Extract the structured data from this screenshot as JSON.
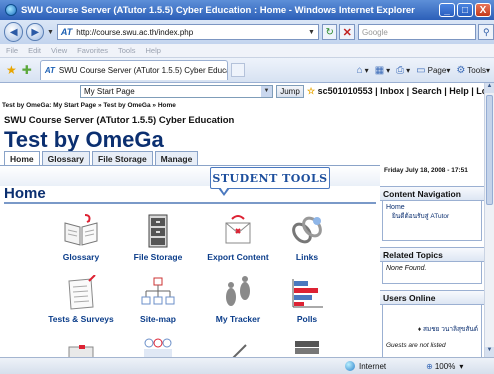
{
  "window": {
    "title": "SWU Course Server (ATutor 1.5.5) Cyber Education : Home - Windows Internet Explorer",
    "minimize": "_",
    "maximize": "□",
    "close": "X"
  },
  "address": {
    "url": "http://course.swu.ac.th/index.php",
    "search_placeholder": "Google"
  },
  "menu": [
    "File",
    "Edit",
    "View",
    "Favorites",
    "Tools",
    "Help"
  ],
  "browser_tab": {
    "label": "SWU Course Server (ATutor 1.5.5) Cyber Education :...",
    "tools": [
      {
        "icon": "page-icon",
        "label": "Page"
      },
      {
        "icon": "tools-icon",
        "label": "Tools"
      }
    ]
  },
  "page": {
    "jump_select": "My Start Page",
    "jump_button": "Jump",
    "userbar": "sc501010553 | Inbox | Search | Help | Log-out",
    "breadcrumb": "Test by OmeGa: My Start Page » Test by OmeGa » Home",
    "server_title": "SWU Course Server (ATutor 1.5.5) Cyber Education",
    "course_title": "Test by OmeGa",
    "tabs": [
      "Home",
      "Glossary",
      "File Storage",
      "Manage"
    ],
    "date": "Friday July 18, 2008 - 17:51",
    "heading": "Home",
    "callout": "STUDENT TOOLS",
    "tools": [
      {
        "label": "Glossary",
        "icon": "glossary-icon"
      },
      {
        "label": "File Storage",
        "icon": "file-storage-icon"
      },
      {
        "label": "Export Content",
        "icon": "export-content-icon"
      },
      {
        "label": "Links",
        "icon": "links-icon"
      },
      {
        "label": "Tests & Surveys",
        "icon": "tests-surveys-icon"
      },
      {
        "label": "Site-map",
        "icon": "site-map-icon"
      },
      {
        "label": "My Tracker",
        "icon": "my-tracker-icon"
      },
      {
        "label": "Polls",
        "icon": "polls-icon"
      }
    ]
  },
  "sidebar": {
    "content_nav": {
      "heading": "Content Navigation",
      "home": "Home",
      "sub": "ยินดีต้อนรับสู่ ATutor"
    },
    "related": {
      "heading": "Related Topics",
      "text": "None Found."
    },
    "online": {
      "heading": "Users Online",
      "user": "สมชย วนาลิสุขสันต์",
      "guests": "Guests are not listed"
    }
  },
  "status": {
    "zone": "Internet",
    "zoom": "100%"
  },
  "colors": {
    "accent": "#0b2f70",
    "link": "#0b3d8a",
    "titlebar": "#2c5fb8"
  }
}
